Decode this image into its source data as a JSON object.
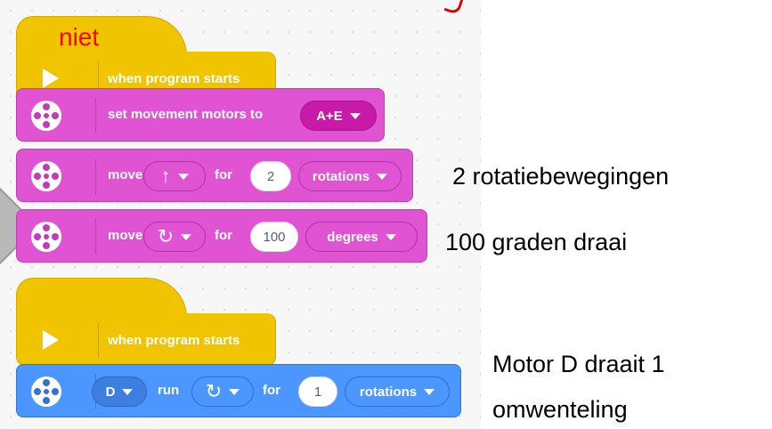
{
  "annotation_top": "niet",
  "stack1": {
    "hat_label": "when program starts",
    "set_block": {
      "label": "set movement motors to",
      "value": "A+E"
    },
    "move_block_1": {
      "move_label": "move",
      "direction_icon": "arrow-up-icon",
      "direction_glyph": "↑",
      "for_label": "for",
      "amount": "2",
      "unit": "rotations"
    },
    "move_block_2": {
      "move_label": "move",
      "direction_icon": "rotate-clockwise-icon",
      "direction_glyph": "↻",
      "for_label": "for",
      "amount": "100",
      "unit": "degrees"
    }
  },
  "stack2": {
    "hat_label": "when program starts",
    "run_block": {
      "motor": "D",
      "run_label": "run",
      "direction_icon": "rotate-clockwise-icon",
      "direction_glyph": "↻",
      "for_label": "for",
      "amount": "1",
      "unit": "rotations"
    }
  },
  "annotations": {
    "rotations_note": "2 rotatiebewegingen",
    "degrees_note": "100 graden draai",
    "motor_note_line1": "Motor D draait 1",
    "motor_note_line2": "omwenteling"
  },
  "colors": {
    "event_yellow": "#f1c400",
    "movement_pink": "#e053d2",
    "motor_blue": "#4c97ff",
    "annotation_red": "#ff0000"
  }
}
